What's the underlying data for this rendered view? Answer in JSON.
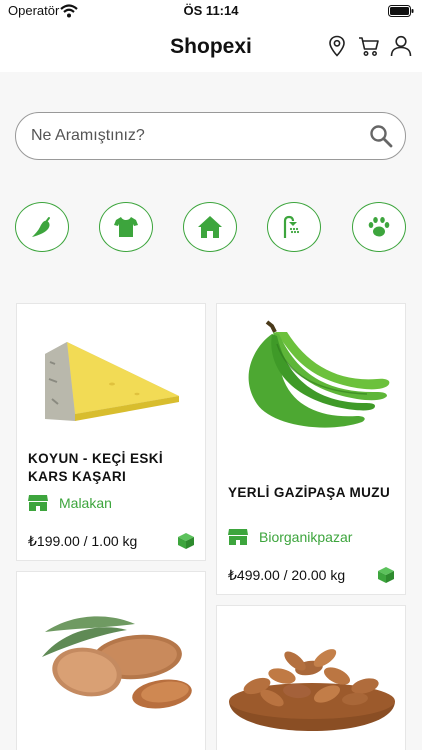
{
  "status_bar": {
    "carrier": "Operatör",
    "time": "ÖS 11:14"
  },
  "header": {
    "title": "Shopexi",
    "icons": [
      "location-icon",
      "cart-icon",
      "user-icon"
    ]
  },
  "search": {
    "placeholder": "Ne Aramıştınız?",
    "value": ""
  },
  "categories": [
    {
      "icon": "pepper-icon"
    },
    {
      "icon": "tshirt-icon"
    },
    {
      "icon": "home-icon"
    },
    {
      "icon": "shower-icon"
    },
    {
      "icon": "paw-icon"
    }
  ],
  "products": [
    {
      "name": "KOYUN - KEÇİ ESKİ KARS KAŞARI",
      "vendor": "Malakan",
      "price": "₺199.00 / 1.00 kg",
      "image": "cheese-image"
    },
    {
      "name": "YERLİ GAZİPAŞA MUZU",
      "vendor": "Biorganikpazar",
      "price": "₺499.00 / 20.00 kg",
      "image": "banana-image"
    },
    {
      "name": "",
      "vendor": "",
      "price": "",
      "image": "almond-shell-image"
    },
    {
      "name": "",
      "vendor": "",
      "price": "",
      "image": "almond-bowl-image"
    }
  ],
  "colors": {
    "accent": "#3da53d",
    "background": "#f7f7f7",
    "card": "#ffffff",
    "text": "#111111"
  }
}
